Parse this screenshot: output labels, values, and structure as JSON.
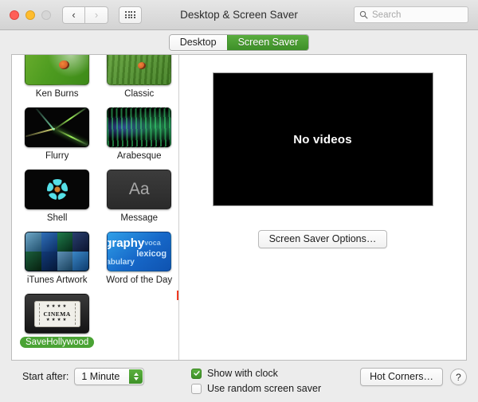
{
  "window": {
    "title": "Desktop & Screen Saver",
    "traffic_lights": [
      "close",
      "minimize",
      "zoom"
    ],
    "nav": {
      "back_icon": "chevron-left-icon",
      "forward_icon": "chevron-right-icon",
      "grid_icon": "grid-apps-icon"
    },
    "search": {
      "placeholder": "Search",
      "value": "",
      "icon": "search-icon"
    }
  },
  "tabs": [
    {
      "label": "Desktop",
      "active": false
    },
    {
      "label": "Screen Saver",
      "active": true
    }
  ],
  "screensavers": [
    {
      "label": "Ken Burns",
      "art": "t-kenburns",
      "selected": false
    },
    {
      "label": "Classic",
      "art": "t-classic",
      "selected": false
    },
    {
      "label": "Flurry",
      "art": "t-flurry",
      "selected": false
    },
    {
      "label": "Arabesque",
      "art": "t-arabesque",
      "selected": false
    },
    {
      "label": "Shell",
      "art": "t-shell",
      "selected": false
    },
    {
      "label": "Message",
      "art": "t-message",
      "selected": false
    },
    {
      "label": "iTunes Artwork",
      "art": "t-itunes",
      "selected": false
    },
    {
      "label": "Word of the Day",
      "art": "t-word",
      "selected": false
    },
    {
      "label": "SaveHollywood",
      "art": "t-hollywood",
      "selected": true
    }
  ],
  "preview": {
    "message": "No videos",
    "background_color": "#000000"
  },
  "options_button": {
    "label": "Screen Saver Options…"
  },
  "bottom": {
    "start_after_label": "Start after:",
    "start_after_value": "1 Minute",
    "stepper_icon": "stepper-up-down-icon",
    "checkboxes": [
      {
        "label": "Show with clock",
        "checked": true
      },
      {
        "label": "Use random screen saver",
        "checked": false
      }
    ],
    "hot_corners_label": "Hot Corners…",
    "help_label": "?"
  },
  "colors": {
    "accent_green": "#4aa334",
    "tab_active_green": "#3d8f28",
    "window_bg": "#ececec",
    "panel_bg": "#ffffff"
  },
  "message_thumb_text": "Aa",
  "word_thumb_text": {
    "w1": "graphy",
    "w2": "lexicog",
    "w3": "voca",
    "w4": "abulary"
  },
  "hollywood_thumb": {
    "stars_top": "★★★★",
    "title": "CINEMA",
    "stars_bottom": "★★★★"
  }
}
